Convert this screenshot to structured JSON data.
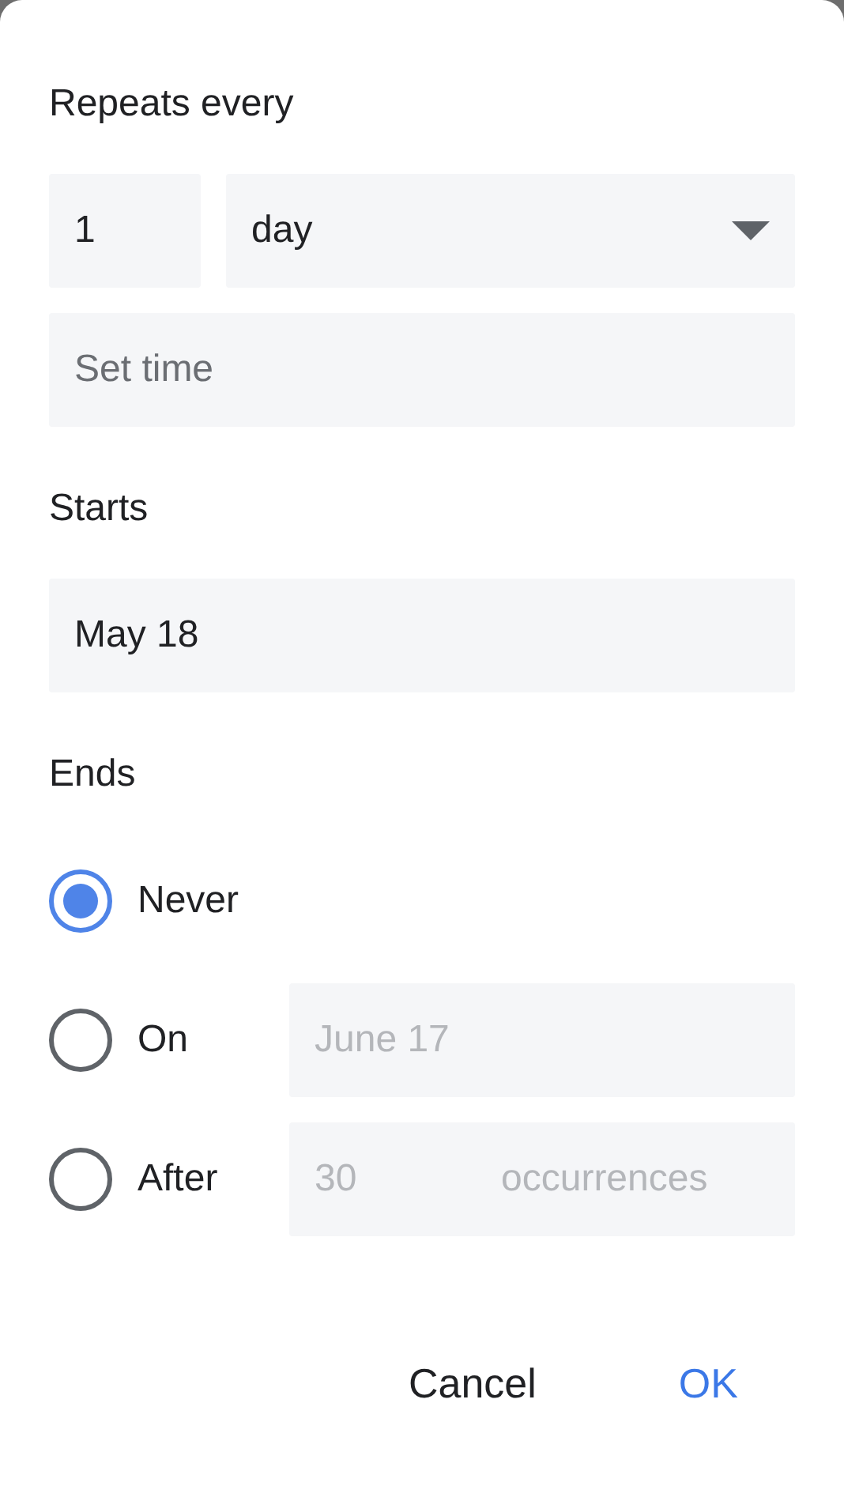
{
  "heading_repeats": "Repeats every",
  "repeat": {
    "count": "1",
    "unit": "day"
  },
  "time": {
    "placeholder": "Set time"
  },
  "heading_starts": "Starts",
  "start_date": "May 18",
  "heading_ends": "Ends",
  "end_options": [
    {
      "kind": "plain",
      "label": "Never",
      "selected": true
    },
    {
      "kind": "date",
      "label": "On",
      "selected": false,
      "value": "June 17",
      "disabled": true
    },
    {
      "kind": "count",
      "label": "After",
      "selected": false,
      "value": "30",
      "suffix": "occurrences",
      "disabled": true
    }
  ],
  "buttons": [
    {
      "label": "Cancel",
      "kind": "text"
    },
    {
      "label": "OK",
      "kind": "primary"
    }
  ]
}
